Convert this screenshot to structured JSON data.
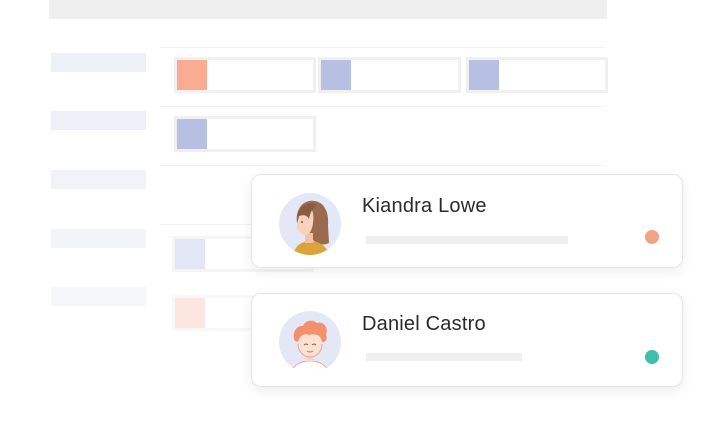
{
  "users": [
    {
      "name": "Kiandra Lowe",
      "status_color": "#f4a284",
      "avatar_icon": "woman-avatar-icon"
    },
    {
      "name": "Daniel Castro",
      "status_color": "#3fbfaa",
      "avatar_icon": "man-avatar-icon"
    }
  ],
  "colors": {
    "salmon": "#f9ac92",
    "lavender": "#b7bfe3",
    "lavender_light": "#e2e6f5",
    "salmon_light": "#fbe6e0"
  }
}
